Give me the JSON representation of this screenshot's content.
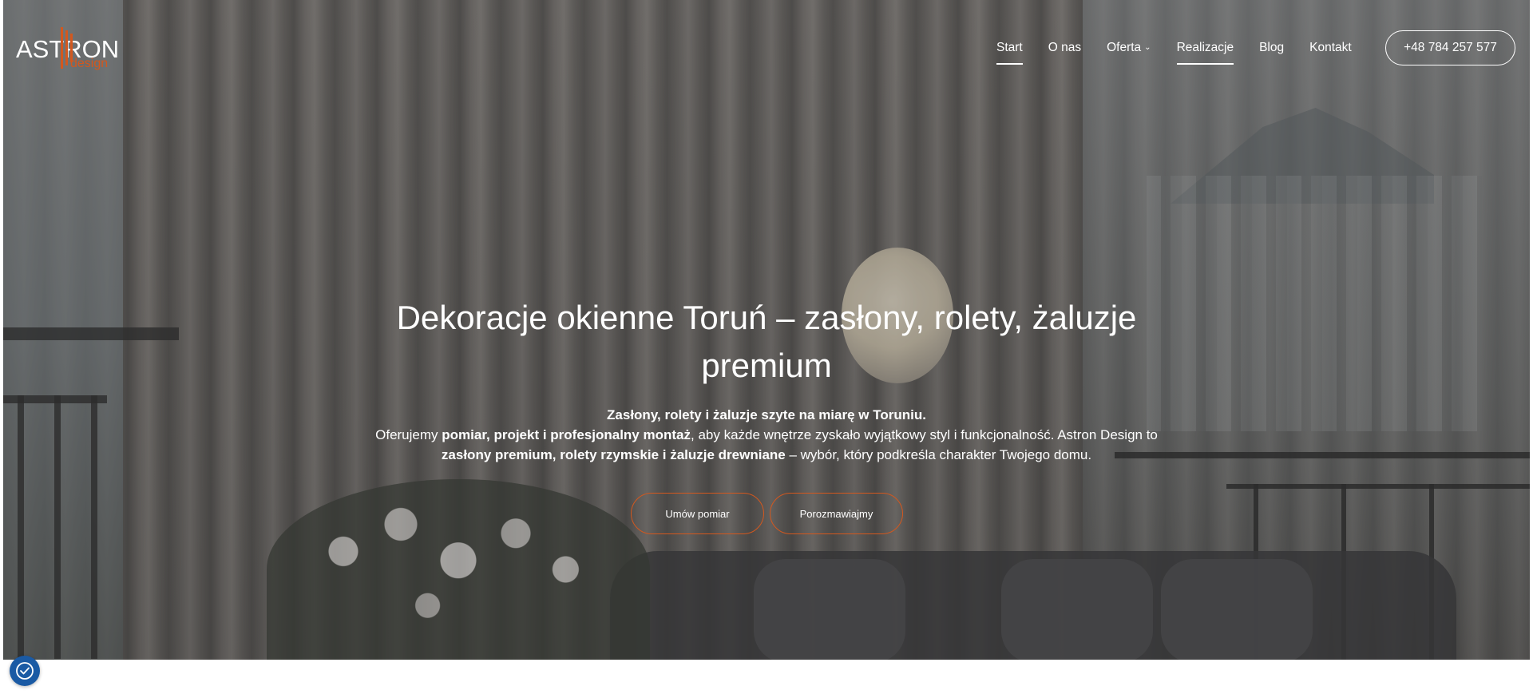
{
  "brand": {
    "name": "ASTRON",
    "sub": "design",
    "accent_color": "#d3581e"
  },
  "nav": {
    "items": [
      {
        "label": "Start",
        "active": true
      },
      {
        "label": "O nas",
        "active": false
      },
      {
        "label": "Oferta",
        "active": false,
        "has_dropdown": true
      },
      {
        "label": "Realizacje",
        "active": true
      },
      {
        "label": "Blog",
        "active": false
      },
      {
        "label": "Kontakt",
        "active": false
      }
    ],
    "phone": "+48 784 257 577"
  },
  "hero": {
    "title": "Dekoracje okienne Toruń – zasłony, rolety, żaluzje premium",
    "desc_line1": "Zasłony, rolety i żaluzje szyte na miarę w Toruniu.",
    "desc_p2_a": "Oferujemy ",
    "desc_p2_b": "pomiar, projekt i profesjonalny montaż",
    "desc_p2_c": ", aby każde wnętrze zyskało wyjątkowy styl i funkcjonalność. Astron Design to ",
    "desc_p2_d": "zasłony premium, rolety rzymskie i żaluzje drewniane",
    "desc_p2_e": " – wybór, który podkreśla charakter Twojego domu.",
    "cta_primary": "Umów pomiar",
    "cta_secondary": "Porozmawiajmy"
  },
  "cookie": {
    "icon": "cookie-settings-icon"
  }
}
